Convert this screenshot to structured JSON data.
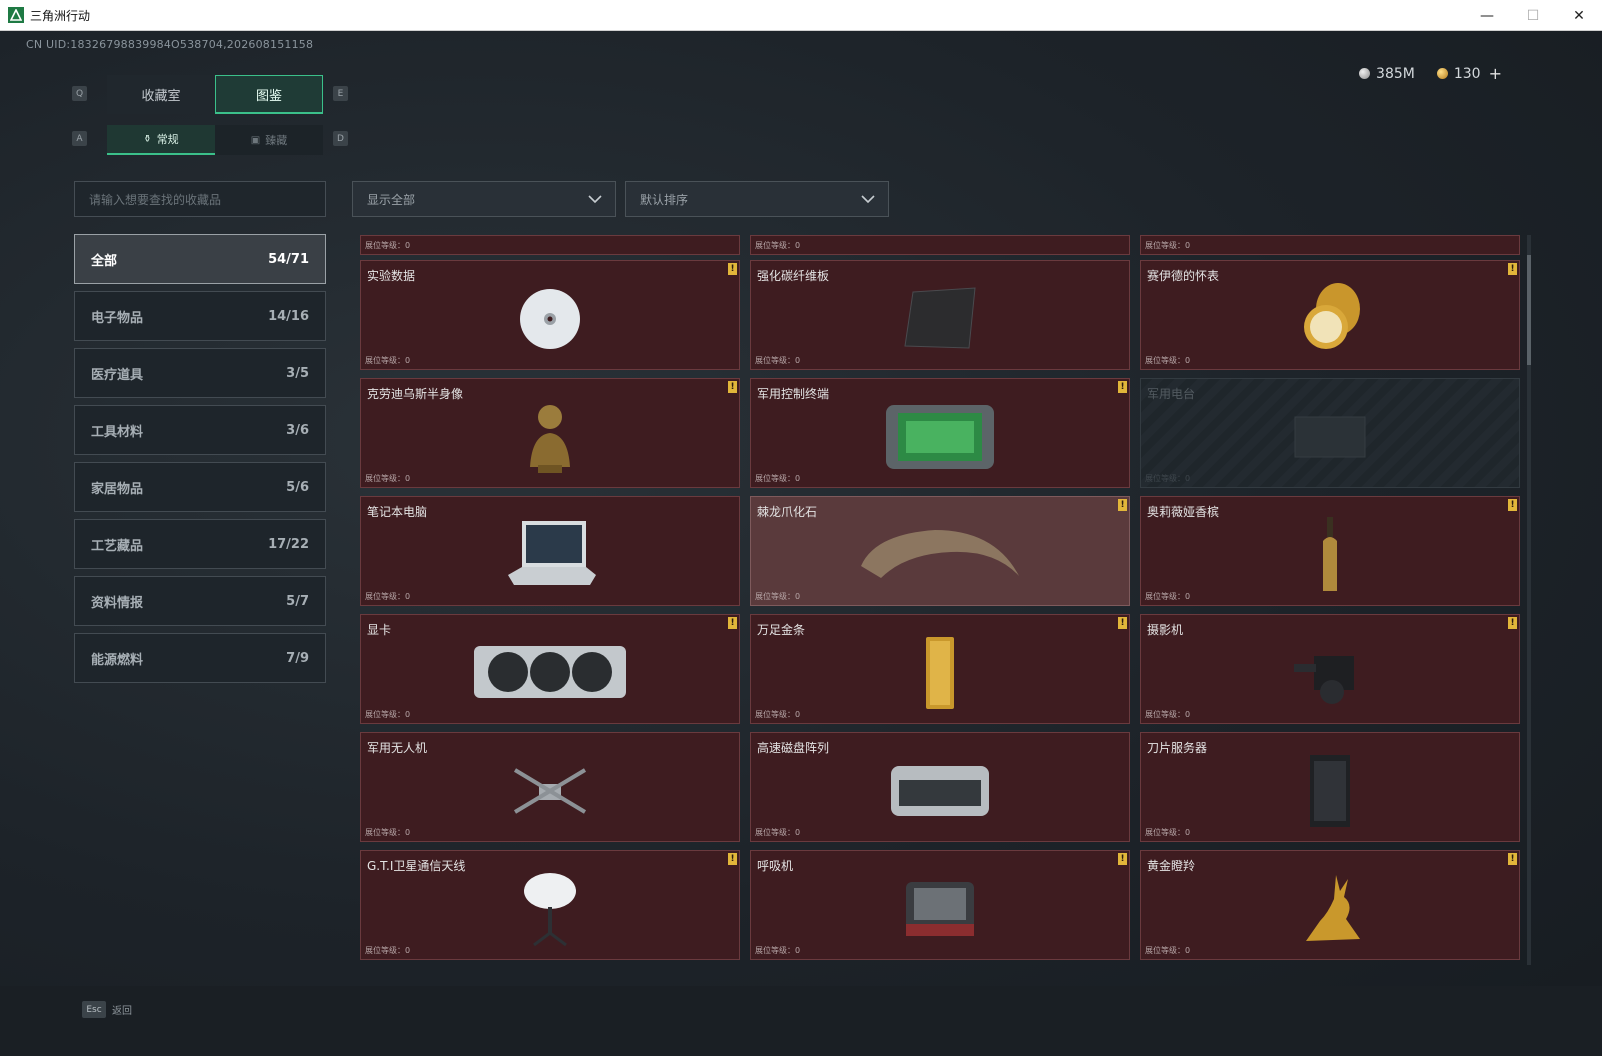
{
  "window": {
    "title": "三角洲行动"
  },
  "uid": "CN UID:18326798839984O538704,202608151158",
  "currency": {
    "silver": "385M",
    "gold": "130",
    "add": "+"
  },
  "keys": {
    "q": "Q",
    "e": "E",
    "a": "A",
    "d": "D",
    "esc": "Esc"
  },
  "tabs": [
    {
      "label": "收藏室"
    },
    {
      "label": "图鉴"
    }
  ],
  "subtabs": [
    {
      "label": "常规",
      "icon": "flask-icon"
    },
    {
      "label": "臻藏",
      "icon": "image-icon"
    }
  ],
  "search": {
    "placeholder": "请输入想要查找的收藏品"
  },
  "filters": {
    "show": "显示全部",
    "sort": "默认排序"
  },
  "categories": [
    {
      "label": "全部",
      "count": "54/71"
    },
    {
      "label": "电子物品",
      "count": "14/16"
    },
    {
      "label": "医疗道具",
      "count": "3/5"
    },
    {
      "label": "工具材料",
      "count": "3/6"
    },
    {
      "label": "家居物品",
      "count": "5/6"
    },
    {
      "label": "工艺藏品",
      "count": "17/22"
    },
    {
      "label": "资料情报",
      "count": "5/7"
    },
    {
      "label": "能源燃料",
      "count": "7/9"
    }
  ],
  "level_label": "展位等级：0",
  "items": [
    {
      "name": "实验数据",
      "badge": "!"
    },
    {
      "name": "强化碳纤维板",
      "badge": ""
    },
    {
      "name": "赛伊德的怀表",
      "badge": "!"
    },
    {
      "name": "克劳迪乌斯半身像",
      "badge": "!"
    },
    {
      "name": "军用控制终端",
      "badge": "!"
    },
    {
      "name": "军用电台",
      "badge": ""
    },
    {
      "name": "笔记本电脑",
      "badge": ""
    },
    {
      "name": "棘龙爪化石",
      "badge": "!"
    },
    {
      "name": "奥莉薇娅香槟",
      "badge": "!"
    },
    {
      "name": "显卡",
      "badge": "!"
    },
    {
      "name": "万足金条",
      "badge": "!"
    },
    {
      "name": "摄影机",
      "badge": "!"
    },
    {
      "name": "军用无人机",
      "badge": ""
    },
    {
      "name": "高速磁盘阵列",
      "badge": ""
    },
    {
      "name": "刀片服务器",
      "badge": ""
    },
    {
      "name": "G.T.I卫星通信天线",
      "badge": "!"
    },
    {
      "name": "呼吸机",
      "badge": "!"
    },
    {
      "name": "黄金瞪羚",
      "badge": "!"
    }
  ],
  "footer": {
    "back": "返回"
  }
}
